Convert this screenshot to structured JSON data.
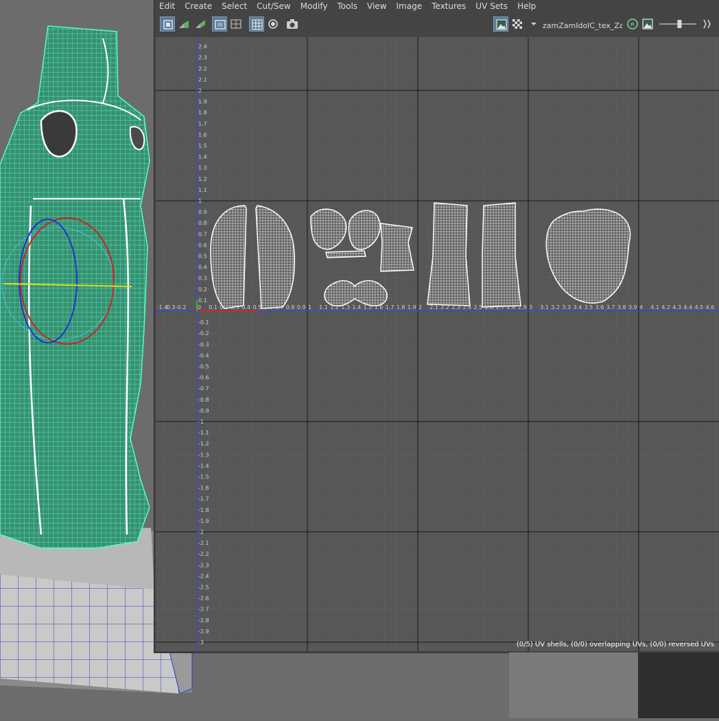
{
  "menu": {
    "items": [
      "Edit",
      "Create",
      "Select",
      "Cut/Sew",
      "Modify",
      "Tools",
      "View",
      "Image",
      "Textures",
      "UV Sets",
      "Help"
    ]
  },
  "toolbar": {
    "texture_name": "zamZamIdolC_tex_Zam",
    "zoom_slider_value": 0.55
  },
  "uv_grid": {
    "u_labels": [
      "-1.4",
      "-0.3",
      "-0.2",
      "0",
      "0.1",
      "0.2",
      "0.3",
      "0.4",
      "0.5",
      "0.6",
      "0.7",
      "0.8",
      "0.9",
      "1",
      "1.1",
      "1.2",
      "1.3",
      "1.4",
      "1.5",
      "1.6",
      "1.7",
      "1.8",
      "1.9",
      "2",
      "2.1",
      "2.2",
      "2.3",
      "2.4",
      "2.5",
      "2.6",
      "2.7",
      "2.8",
      "2.9",
      "3",
      "3.1",
      "3.2",
      "3.3",
      "3.4",
      "3.5",
      "3.6",
      "3.7",
      "3.8",
      "3.9",
      "4",
      "4.1",
      "4.2",
      "4.3",
      "4.4",
      "4.5",
      "4.6"
    ],
    "v_labels": [
      "2.4",
      "2.3",
      "2.2",
      "2.1",
      "2",
      "1.9",
      "1.8",
      "1.7",
      "1.6",
      "1.5",
      "1.4",
      "1.3",
      "1.2",
      "1.1",
      "1",
      "0.9",
      "0.8",
      "0.7",
      "0.6",
      "0.5",
      "0.4",
      "0.3",
      "0.2",
      "0.1",
      "0",
      "-0.1",
      "-0.2",
      "-0.3",
      "-0.4",
      "-0.5",
      "-0.6",
      "-0.7",
      "-0.8",
      "-0.9",
      "-1",
      "-1.1",
      "-1.2",
      "-1.3",
      "-1.4",
      "-1.5",
      "-1.6",
      "-1.7",
      "-1.8",
      "-1.9",
      "-2",
      "-2.1",
      "-2.2",
      "-2.3",
      "-2.4",
      "-2.5",
      "-2.6",
      "-2.7",
      "-2.8",
      "-2.9",
      "-3",
      "-3.1"
    ]
  },
  "status": {
    "text": "(0/5) UV shells, (0/0) overlapping UVs, (0/0) reversed UVs"
  },
  "colors": {
    "mesh_wire": "#3df0b0",
    "axis_u": "#3b4ccc",
    "axis_v": "#3b4ccc",
    "grid_major": "#1a1a1a",
    "uv_wire": "#ffffff",
    "toggle_on": "#5d7a96"
  }
}
